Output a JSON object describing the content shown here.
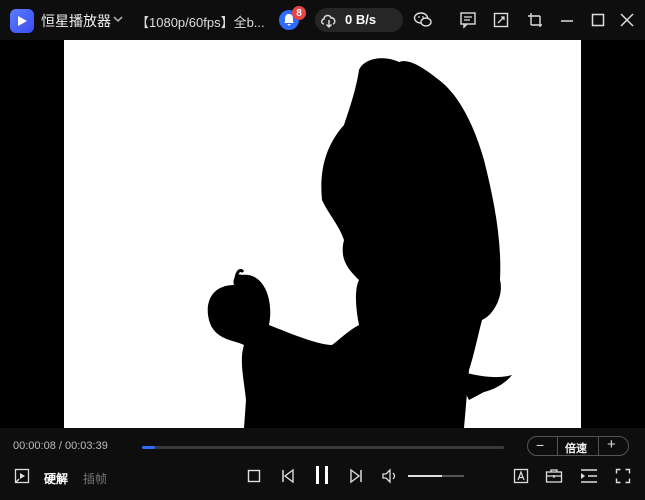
{
  "titlebar": {
    "app_name": "恒星播放器",
    "video_title": "【1080p/60fps】全b...",
    "notification_count": "8",
    "download_speed": "0 B/s"
  },
  "controls": {
    "time_display": "00:00:08 / 00:03:39",
    "progress_fraction": 0.036,
    "rate_label": "倍速",
    "rate_minus": "−",
    "rate_plus": "+",
    "hw_decode_label": "硬解",
    "frame_interp_label": "插帧",
    "volume_fraction": 0.6
  },
  "icons": {
    "logo": "play-logo-icon",
    "dropdown": "chevron-down-icon",
    "bell": "bell-icon",
    "cloud": "cloud-download-icon",
    "wechat": "wechat-icon",
    "feedback": "feedback-icon",
    "screenshot": "crop-icon",
    "pin": "pin-icon",
    "minimize": "minimize-icon",
    "maximize": "maximize-icon",
    "close": "close-icon"
  },
  "colors": {
    "accent": "#2f6bff",
    "badge": "#e64545"
  }
}
